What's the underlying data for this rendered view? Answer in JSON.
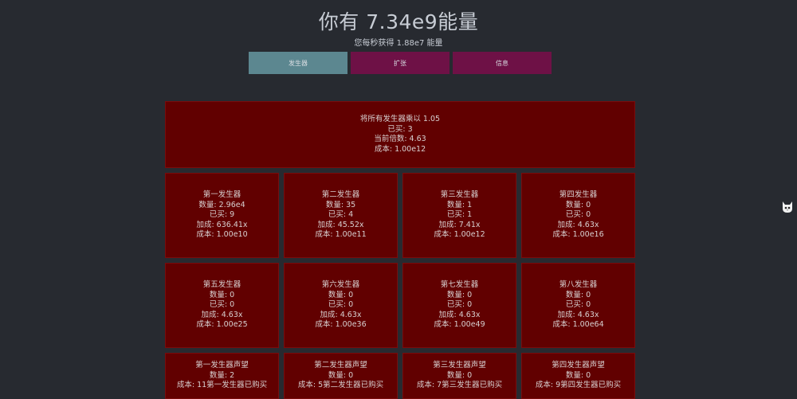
{
  "header": {
    "title": "你有 7.34e9能量",
    "subtitle": "您每秒获得 1.88e7 能量"
  },
  "tabs": [
    {
      "label": "发生器"
    },
    {
      "label": "扩张"
    },
    {
      "label": "信息"
    }
  ],
  "multiplier": {
    "line1": "将所有发生器乘以 1.05",
    "line2": "已买: 3",
    "line3": "当前倍数: 4.63",
    "line4": "成本: 1.00e12"
  },
  "generators": [
    {
      "name": "第一发生器",
      "amount": "数量: 2.96e4",
      "bought": "已买: 9",
      "bonus": "加成: 636.41x",
      "cost": "成本: 1.00e10"
    },
    {
      "name": "第二发生器",
      "amount": "数量: 35",
      "bought": "已买: 4",
      "bonus": "加成: 45.52x",
      "cost": "成本: 1.00e11"
    },
    {
      "name": "第三发生器",
      "amount": "数量: 1",
      "bought": "已买: 1",
      "bonus": "加成: 7.41x",
      "cost": "成本: 1.00e12"
    },
    {
      "name": "第四发生器",
      "amount": "数量: 0",
      "bought": "已买: 0",
      "bonus": "加成: 4.63x",
      "cost": "成本: 1.00e16"
    },
    {
      "name": "第五发生器",
      "amount": "数量: 0",
      "bought": "已买: 0",
      "bonus": "加成: 4.63x",
      "cost": "成本: 1.00e25"
    },
    {
      "name": "第六发生器",
      "amount": "数量: 0",
      "bought": "已买: 0",
      "bonus": "加成: 4.63x",
      "cost": "成本: 1.00e36"
    },
    {
      "name": "第七发生器",
      "amount": "数量: 0",
      "bought": "已买: 0",
      "bonus": "加成: 4.63x",
      "cost": "成本: 1.00e49"
    },
    {
      "name": "第八发生器",
      "amount": "数量: 0",
      "bought": "已买: 0",
      "bonus": "加成: 4.63x",
      "cost": "成本: 1.00e64"
    }
  ],
  "prestige": [
    {
      "name": "第一发生器声望",
      "amount": "数量: 2",
      "cost": "成本: 11第一发生器已购买"
    },
    {
      "name": "第二发生器声望",
      "amount": "数量: 0",
      "cost": "成本: 5第二发生器已购买"
    },
    {
      "name": "第三发生器声望",
      "amount": "数量: 0",
      "cost": "成本: 7第三发生器已购买"
    },
    {
      "name": "第四发生器声望",
      "amount": "数量: 0",
      "cost": "成本: 9第四发生器已购买"
    }
  ],
  "side_icon": "cat-face-icon",
  "colors": {
    "background": "#272a30",
    "card": "#610000",
    "tab_active": "#5c8790",
    "tab_inactive": "#6e1146"
  }
}
